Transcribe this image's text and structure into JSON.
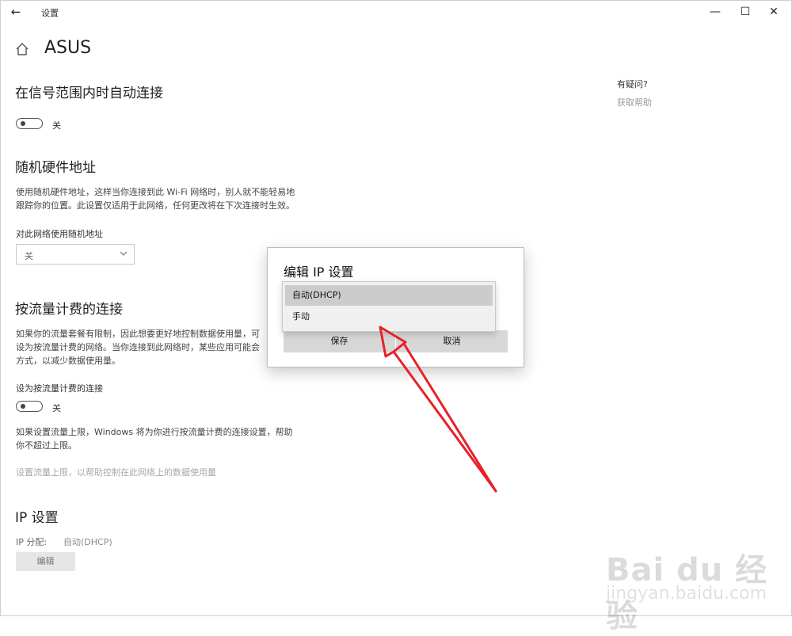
{
  "window": {
    "title": "设置",
    "back_glyph": "←",
    "minimize_glyph": "—",
    "maximize_glyph": "☐",
    "close_glyph": "✕"
  },
  "page": {
    "title": "ASUS"
  },
  "auto_connect": {
    "heading": "在信号范围内时自动连接",
    "toggle_state": "关"
  },
  "random_hw": {
    "heading": "随机硬件地址",
    "description_line1": "使用随机硬件地址，这样当你连接到此 Wi-Fi 网络时，别人就不能轻易地",
    "description_line2": "跟踪你的位置。此设置仅适用于此网络，任何更改将在下次连接时生效。",
    "dropdown_label": "对此网络使用随机地址",
    "dropdown_value": "关"
  },
  "metered": {
    "heading": "按流量计费的连接",
    "description_line1": "如果你的流量套餐有限制，因此想要更好地控制数据使用量，可",
    "description_line2": "设为按流量计费的网络。当你连接到此网络时，某些应用可能会",
    "description_line3": "方式，以减少数据使用量。",
    "toggle_label": "设为按流量计费的连接",
    "toggle_state": "关",
    "limit_desc_line1": "如果设置流量上限，Windows 将为你进行按流量计费的连接设置，帮助",
    "limit_desc_line2": "你不超过上限。",
    "limit_link": "设置流量上限，以帮助控制在此网络上的数据使用量"
  },
  "ip": {
    "heading": "IP 设置",
    "assign_label": "IP 分配:",
    "assign_value": "自动(DHCP)",
    "edit_label": "编辑"
  },
  "help": {
    "title": "有疑问?",
    "link": "获取帮助"
  },
  "dialog": {
    "title": "编辑 IP 设置",
    "options": [
      "自动(DHCP)",
      "手动"
    ],
    "save_label": "保存",
    "cancel_label": "取消"
  },
  "watermark": {
    "brand": "Bai du 经验",
    "url": "jingyan.baidu.com"
  },
  "colors": {
    "annotation_arrow": "#e8202a",
    "menu_selected": "#cccccc",
    "button_bg": "#d7d7d7"
  }
}
